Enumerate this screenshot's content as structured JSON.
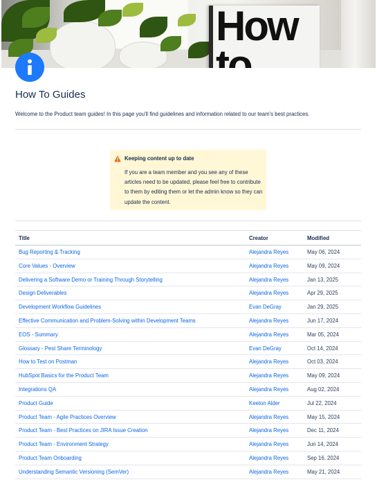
{
  "banner": {
    "image_text": "How to"
  },
  "page": {
    "title": "How To Guides",
    "intro": "Welcome to the Product team guides! In this page you'll find guidelines and information related to our team's best practices."
  },
  "note": {
    "title": "Keeping content up to date",
    "body": "If you are a team member and you see any of these articles need to be updated, please feel free to contribute to them by editing them or let the admin know so they can update the content."
  },
  "table": {
    "headers": [
      "Title",
      "Creator",
      "Modified"
    ],
    "rows": [
      {
        "title": "Bug Reporting & Tracking",
        "creator": "Alejandra Reyes",
        "modified": "May 06, 2024"
      },
      {
        "title": "Core Values - Overview",
        "creator": "Alejandra Reyes",
        "modified": "May 09, 2024"
      },
      {
        "title": "Delivering a Software Demo or Training Through Storytelling",
        "creator": "Alejandra Reyes",
        "modified": "Jan 13, 2025"
      },
      {
        "title": "Design Deliverables",
        "creator": "Alejandra Reyes",
        "modified": "Apr 29, 2025"
      },
      {
        "title": "Development Workflow Guidelines",
        "creator": "Evan DeGray",
        "modified": "Jan 29, 2025"
      },
      {
        "title": "Effective Communication and Problem-Solving within Development Teams",
        "creator": "Alejandra Reyes",
        "modified": "Jun 17, 2024"
      },
      {
        "title": "EOS - Summary",
        "creator": "Alejandra Reyes",
        "modified": "Mar 05, 2024"
      },
      {
        "title": "Glossary - Pest Share Terminology",
        "creator": "Evan DeGray",
        "modified": "Oct 14, 2024"
      },
      {
        "title": "How to Test on Postman",
        "creator": "Alejandra Reyes",
        "modified": "Oct 03, 2024"
      },
      {
        "title": "HubSpot Basics for the Product Team",
        "creator": "Alejandra Reyes",
        "modified": "May 09, 2024"
      },
      {
        "title": "Integrations QA",
        "creator": "Alejandra Reyes",
        "modified": "Aug 02, 2024"
      },
      {
        "title": "Product Guide",
        "creator": "Keeton Alder",
        "modified": "Jul 22, 2024"
      },
      {
        "title": "Product Team - Agile Practices Overview",
        "creator": "Alejandra Reyes",
        "modified": "May 15, 2024"
      },
      {
        "title": "Product Team - Best Practices on JIRA Issue Creation",
        "creator": "Alejandra Reyes",
        "modified": "Dec 11, 2024"
      },
      {
        "title": "Product Team - Environment Strategy",
        "creator": "Alejandra Reyes",
        "modified": "Jun 14, 2024"
      },
      {
        "title": "Product Team Onboarding",
        "creator": "Alejandra Reyes",
        "modified": "Sep 16, 2024"
      },
      {
        "title": "Understanding Semantic Versioning (SemVer)",
        "creator": "Alejandra Reyes",
        "modified": "May 21, 2024"
      }
    ]
  },
  "colors": {
    "link": "#0c66e4",
    "info_badge": "#1d7afc",
    "note_bg": "#fff7d6",
    "warning": "#e56910"
  },
  "icons": {
    "page_icon": "info-icon",
    "note_icon": "warning-icon"
  }
}
